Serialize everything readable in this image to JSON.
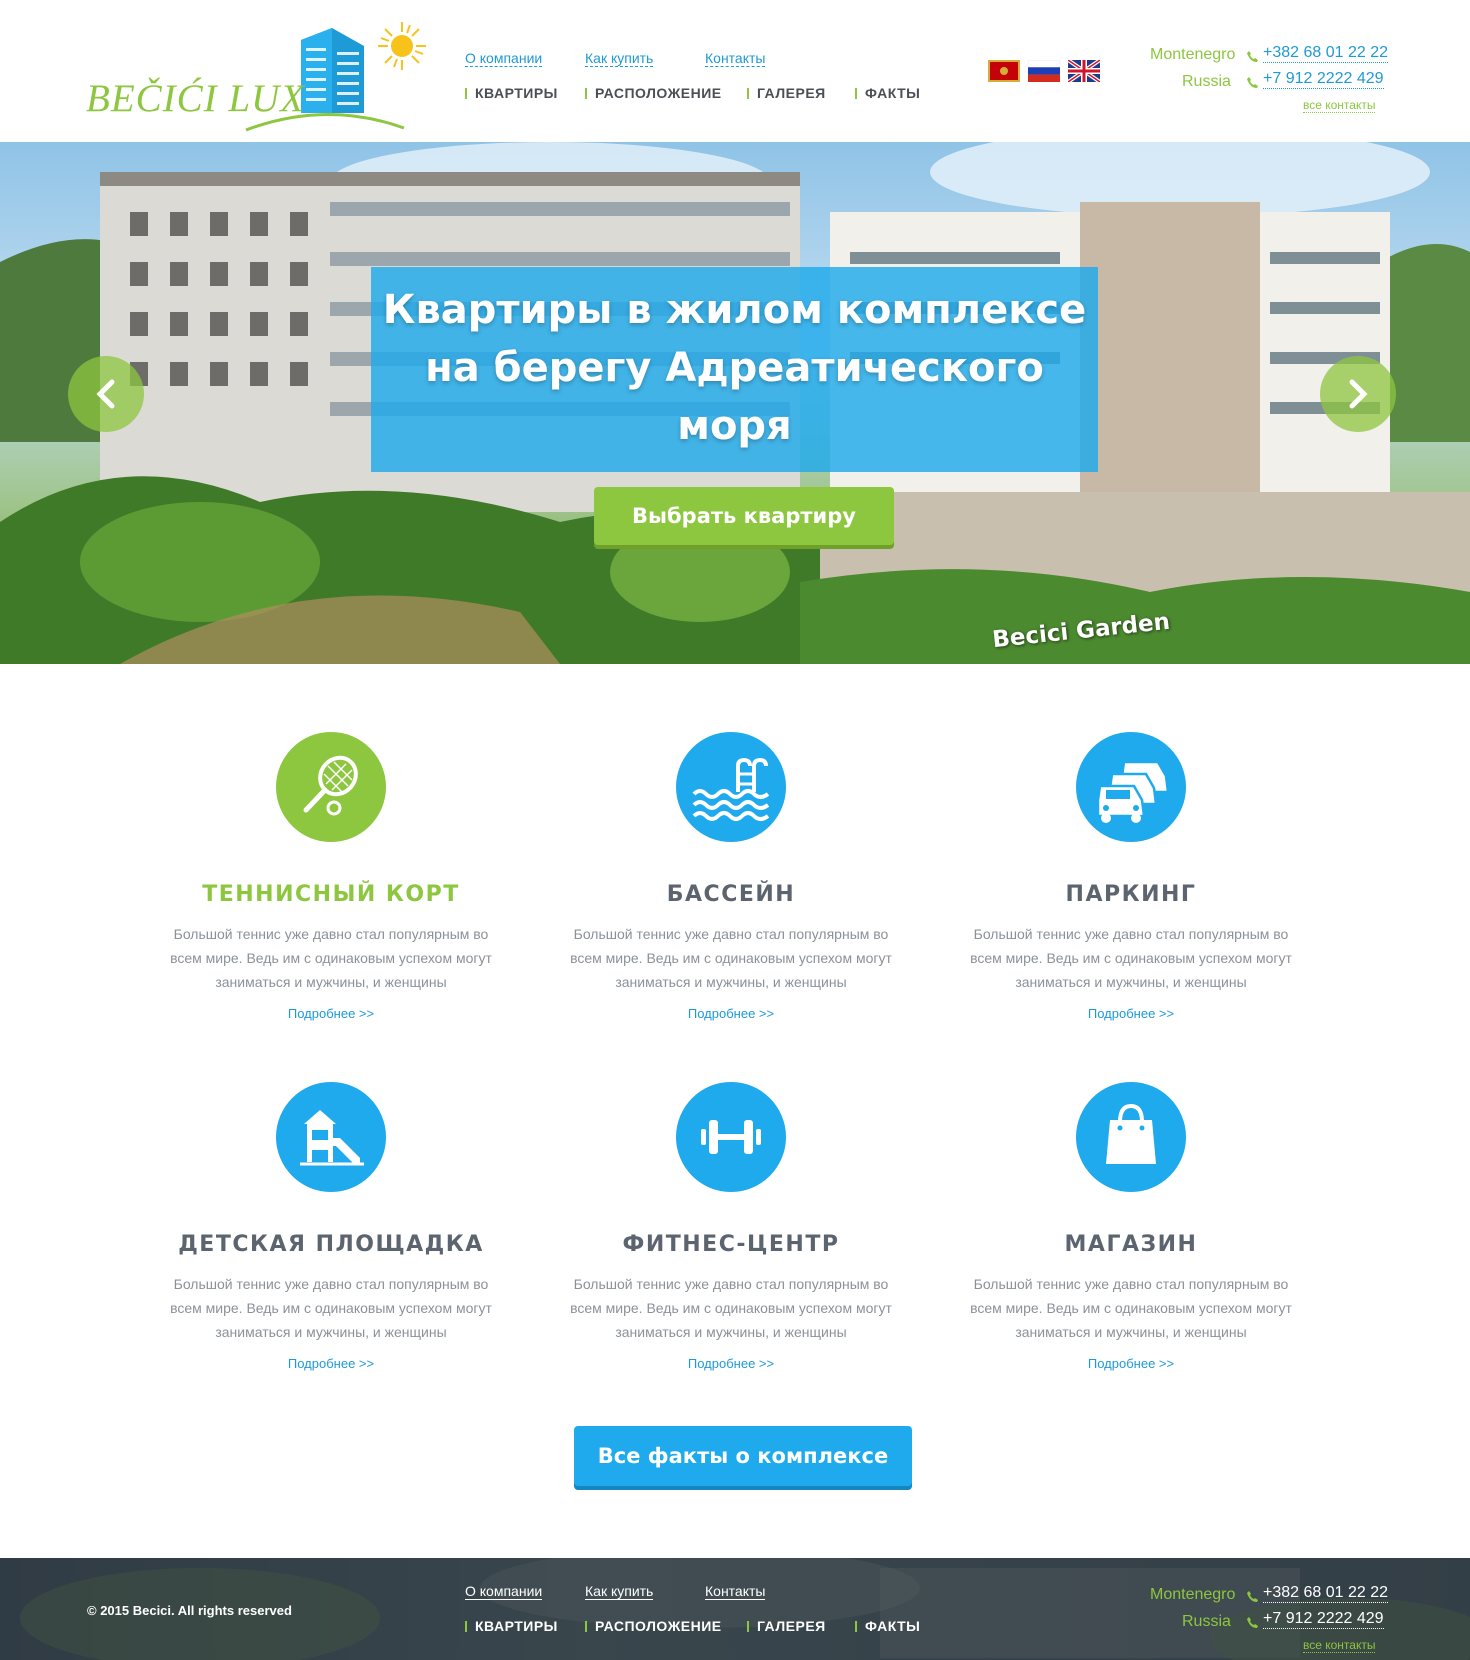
{
  "brand": {
    "logo_text": "BEČIĆI LUX"
  },
  "top_nav": [
    "О компании",
    "Как купить",
    "Контакты"
  ],
  "main_nav": [
    "КВАРТИРЫ",
    "РАСПОЛОЖЕНИЕ",
    "ГАЛЕРЕЯ",
    "ФАКТЫ"
  ],
  "languages": [
    "montenegro-flag",
    "russia-flag",
    "uk-flag"
  ],
  "contacts": {
    "items": [
      {
        "country": "Montenegro",
        "phone": "+382 68 01 22 22"
      },
      {
        "country": "Russia",
        "phone": "+7 912 2222 429"
      }
    ],
    "all_link": "все контакты"
  },
  "hero": {
    "title_lines": [
      "Квартиры в жилом комплексе",
      "на берегу Адреатического",
      "моря"
    ],
    "button": "Выбрать квартиру",
    "watermark": "Becici Garden"
  },
  "features": [
    {
      "icon": "tennis-racket-icon",
      "title": "ТЕННИСНЫЙ КОРТ",
      "highlight": true,
      "text": "Большой теннис уже давно стал популярным во всем мире. Ведь им с одинаковым успехом могут заниматься и мужчины, и женщины",
      "more": "Подробнее >>"
    },
    {
      "icon": "swimming-pool-icon",
      "title": "БАССЕЙН",
      "highlight": false,
      "text": "Большой теннис уже давно стал популярным во всем мире. Ведь им с одинаковым успехом могут заниматься и мужчины, и женщины",
      "more": "Подробнее >>"
    },
    {
      "icon": "cars-icon",
      "title": "ПАРКИНГ",
      "highlight": false,
      "text": "Большой теннис уже давно стал популярным во всем мире. Ведь им с одинаковым успехом могут заниматься и мужчины, и женщины",
      "more": "Подробнее >>"
    },
    {
      "icon": "playground-icon",
      "title": "ДЕТСКАЯ ПЛОЩАДКА",
      "highlight": false,
      "text": "Большой теннис уже давно стал популярным во всем мире. Ведь им с одинаковым успехом могут заниматься и мужчины, и женщины",
      "more": "Подробнее >>"
    },
    {
      "icon": "dumbbell-icon",
      "title": "ФИТНЕС-ЦЕНТР",
      "highlight": false,
      "text": "Большой теннис уже давно стал популярным во всем мире. Ведь им с одинаковым успехом могут заниматься и мужчины, и женщины",
      "more": "Подробнее >>"
    },
    {
      "icon": "shopping-bag-icon",
      "title": "МАГАЗИН",
      "highlight": false,
      "text": "Большой теннис уже давно стал популярным во всем мире. Ведь им с одинаковым успехом могут заниматься и мужчины, и женщины",
      "more": "Подробнее >>"
    }
  ],
  "facts_button": "Все факты о комплексе",
  "footer": {
    "copyright": "© 2015 Becici. All rights reserved"
  },
  "colors": {
    "green": "#8dc63f",
    "blue": "#1eaaec",
    "link_blue": "#1e9ad6",
    "text_gray": "#8b9199",
    "heading_gray": "#5c6470"
  }
}
